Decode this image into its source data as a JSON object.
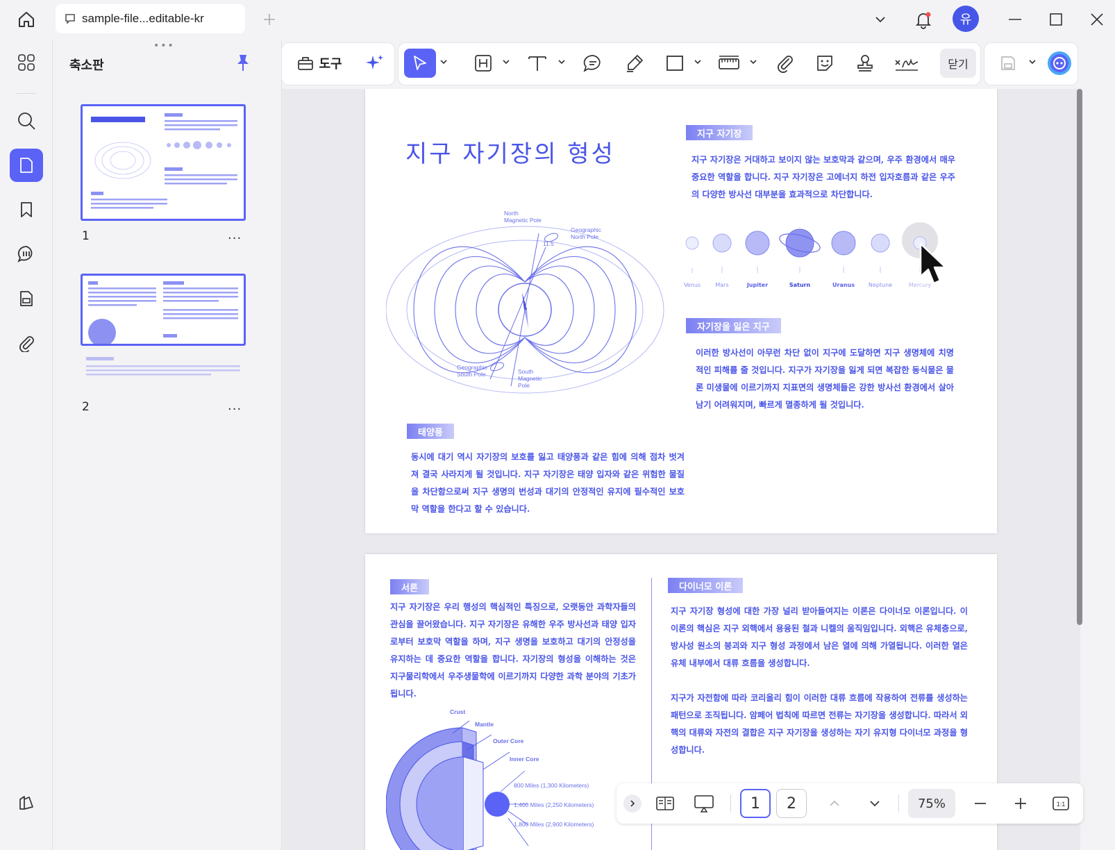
{
  "titlebar": {
    "tab_title": "sample-file...editable-kr",
    "avatar_initial": "유"
  },
  "panel": {
    "title": "축소판",
    "pages": [
      {
        "number": "1",
        "more": "..."
      },
      {
        "number": "2",
        "more": "..."
      }
    ]
  },
  "toolbar": {
    "tools_label": "도구",
    "close_label": "닫기"
  },
  "page1": {
    "title": "지구 자기장의 형성",
    "sec1_tag": "지구 자기장",
    "sec1_text": "지구 자기장은 거대하고 보이지 않는 보호막과 같으며, 우주 환경에서 매우 중요한 역할을 합니다. 지구 자기장은 고에너지 하전 입자호름과 같은 우주의 다양한 방사선 대부분을 효과적으로 차단합니다.",
    "planets": [
      "Venus",
      "Mars",
      "Jupiter",
      "Saturn",
      "Uranus",
      "Neptune",
      "Mercury"
    ],
    "diagram": {
      "north_magnetic": "North\nMagnetic Pole",
      "geo_north": "Geographic\nNorth Pole",
      "geo_south": "Geographic\nSouth Pole",
      "south_magnetic": "South\nMagnetic\nPole",
      "angle": "11.5"
    },
    "sec2_tag": "자기장을 잃은 지구",
    "sec2_text": "이러한 방사선이 아무런 차단 없이 지구에 도달하면 지구 생명체에 치명적인 피해를 줄 것입니다. 지구가 자기장을 잃게 되면 복잡한 동식물은 물론 미생물에 이르기까지 지표면의 생명체들은 강한 방사선 환경에서 살아남기 어려워지며, 빠르게 멸종하게 될 것입니다.",
    "sec3_tag": "태양풍",
    "sec3_text": "동시에 대기 역시 자기장의 보호를 잃고 태양풍과 같은 힘에 의해 점차 벗겨져 결국 사라지게 될 것입니다. 지구 자기장은 태양 입자와 같은 위험한 물질을 차단함으로써 지구 생명의 번성과 대기의 안정적인 유지에 필수적인 보호막 역할을 한다고 할 수 있습니다."
  },
  "page2": {
    "intro_tag": "서론",
    "intro_text": "지구 자기장은 우리 행성의 핵심적인 특징으로, 오랫동안 과학자들의 관심을 끌어왔습니다. 지구 자기장은 유해한 우주 방사선과 태양 입자로부터 보호막 역할을 하며, 지구 생명을 보호하고 대기의 안정성을 유지하는 데 중요한 역할을 합니다. 자기장의 형성을 이해하는 것은 지구물리학에서 우주생물학에 이르기까지 다양한 과학 분야의 기초가 됩니다.",
    "layers": [
      "Crust",
      "Mantle",
      "Outer Core",
      "Inner Core"
    ],
    "depths": [
      "800 Miles (1,300 Kilometers)",
      "1,400 Miles (2,250 Kilometers)",
      "1,800 Miles (2,900 Kilometers)"
    ],
    "dynamo_tag": "다이너모 이론",
    "dynamo_text1": "지구 자기장 형성에 대한 가장 널리 받아들여지는 이론은 다이너모 이론입니다. 이 이론의 핵심은 지구 외핵에서 용융된 철과 니켈의 움직임입니다. 외핵은 유체층으로, 방사성 원소의 붕괴와 지구 형성 과정에서 남은 열에 의해 가열됩니다. 이러한 열은 유체 내부에서 대류 흐름을 생성합니다.",
    "dynamo_text2": "지구가 자전함에 따라 코리올리 힘이 이러한 대류 흐름에 작용하여 전류를 생성하는 패턴으로 조직됩니다. 암페어 법칙에 따르면 전류는 자기장을 생성합니다. 따라서 외핵의 대류와 자전의 결합은 지구 자기장을 생성하는 자기 유지형 다이너모 과정을 형성합니다."
  },
  "pagebar": {
    "page1": "1",
    "page2": "2",
    "zoom": "75%"
  },
  "colors": {
    "accent": "#5a63f5",
    "doc_blue": "#4a55e8"
  }
}
